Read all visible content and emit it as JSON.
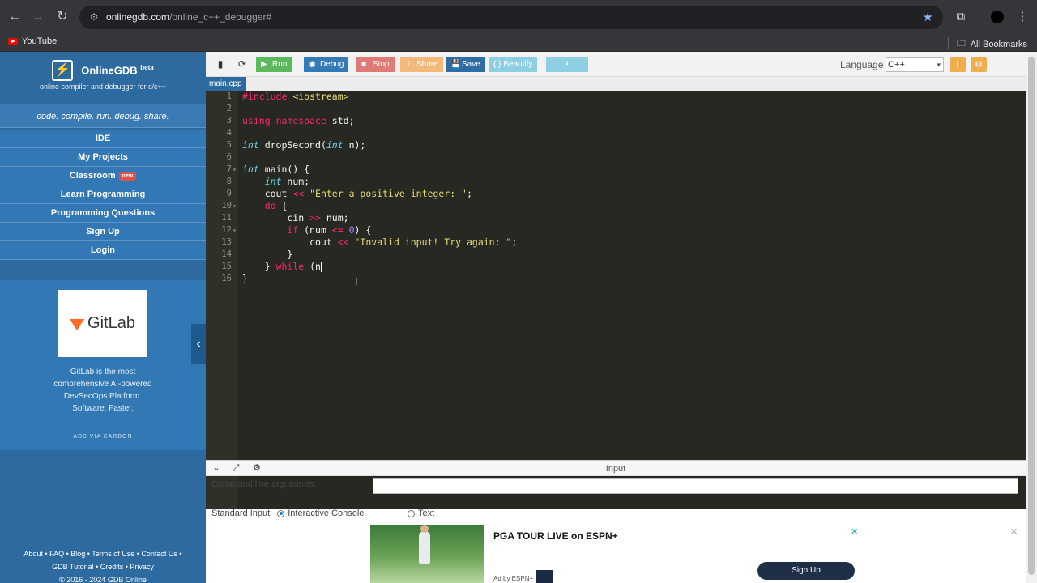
{
  "browser": {
    "url_host": "onlinegdb.com",
    "url_path": "/online_c++_debugger#",
    "bookmark_youtube": "YouTube",
    "all_bookmarks": "All Bookmarks"
  },
  "sidebar": {
    "brand": "OnlineGDB",
    "brand_sup": "beta",
    "tagline": "online compiler and debugger for c/c++",
    "motto": "code. compile. run. debug. share.",
    "menu": [
      {
        "label": "IDE"
      },
      {
        "label": "My Projects"
      },
      {
        "label": "Classroom",
        "badge": "new"
      },
      {
        "label": "Learn Programming"
      },
      {
        "label": "Programming Questions"
      },
      {
        "label": "Sign Up"
      },
      {
        "label": "Login"
      }
    ],
    "ad": {
      "logo_text": "GitLab",
      "copy": "GitLab is the most comprehensive AI-powered DevSecOps Platform. Software. Faster.",
      "via": "ADS VIA CARBON"
    },
    "footer_line1": "About • FAQ • Blog • Terms of Use • Contact Us •",
    "footer_line2": "GDB Tutorial • Credits • Privacy",
    "footer_line3": "© 2016 - 2024 GDB Online"
  },
  "toolbar": {
    "run": "Run",
    "debug": "Debug",
    "stop": "Stop",
    "share": "Share",
    "save": "Save",
    "beautify": "{ } Beautify",
    "language_label": "Language",
    "language_value": "C++",
    "colors": {
      "run": "#5cb85c",
      "debug": "#337ab7",
      "stop": "#d9534f",
      "share": "#f0ad4e",
      "save": "#2e6da4",
      "beautify": "#5bc0de",
      "download": "#5bc0de"
    }
  },
  "editor": {
    "file_tab": "main.cpp",
    "line_numbers": [
      "1",
      "2",
      "3",
      "4",
      "5",
      "6",
      "7",
      "8",
      "9",
      "10",
      "11",
      "12",
      "13",
      "14",
      "15",
      "16"
    ]
  },
  "input_panel": {
    "title": "Input",
    "cmd_label": "Command line arguments:",
    "cmd_value": "",
    "stdin_label": "Standard Input:",
    "opt_interactive": "Interactive Console",
    "opt_text": "Text"
  },
  "ad_banner": {
    "headline": "PGA TOUR LIVE on ESPN+",
    "by": "Ad by ESPN+",
    "cta": "Sign Up",
    "close": "✕"
  }
}
